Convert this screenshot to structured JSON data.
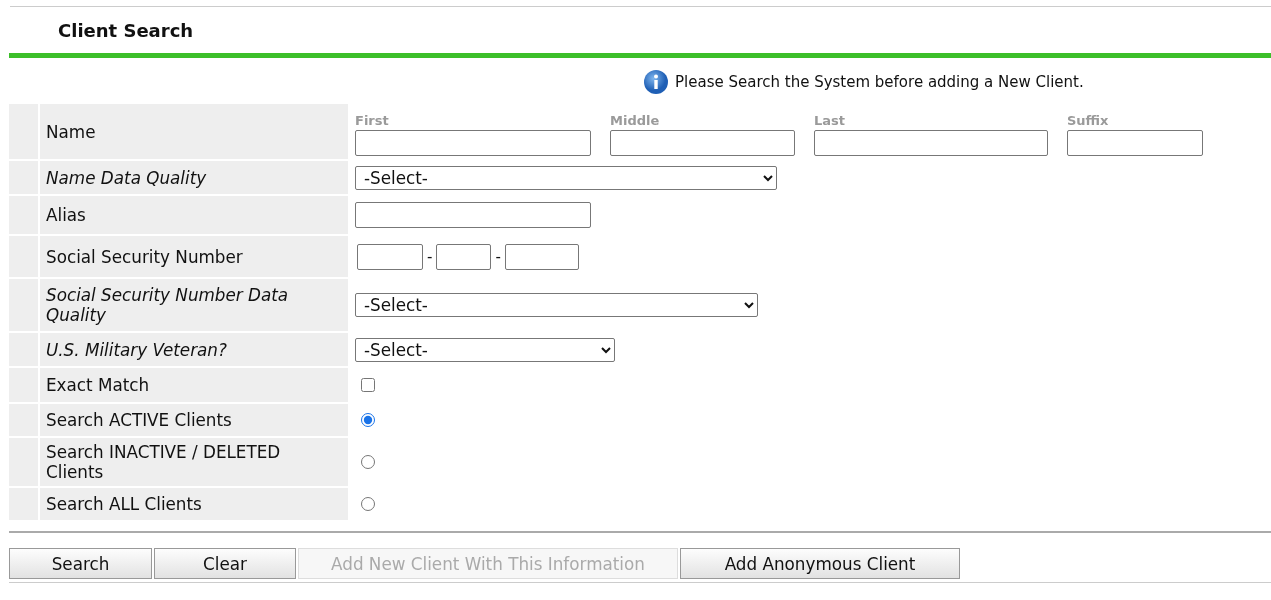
{
  "header": {
    "title": "Client Search"
  },
  "notice": {
    "text": "Please Search the System before adding a New Client."
  },
  "form": {
    "rows": [
      {
        "kind": "name",
        "label": "Name",
        "italic": false,
        "fields": [
          {
            "label": "First"
          },
          {
            "label": "Middle"
          },
          {
            "label": "Last"
          },
          {
            "label": "Suffix"
          }
        ]
      },
      {
        "kind": "select",
        "label": "Name Data Quality",
        "italic": true,
        "value": "-Select-"
      },
      {
        "kind": "text",
        "label": "Alias",
        "italic": false
      },
      {
        "kind": "ssn",
        "label": "Social Security Number",
        "italic": false,
        "separators": [
          "-",
          "-"
        ]
      },
      {
        "kind": "select",
        "label": "Social Security Number Data Quality",
        "italic": true,
        "value": "-Select-"
      },
      {
        "kind": "select",
        "label": "U.S. Military Veteran?",
        "italic": true,
        "value": "-Select-"
      },
      {
        "kind": "checkbox",
        "label": "Exact Match",
        "italic": false,
        "checked": false
      },
      {
        "kind": "radio",
        "label": "Search ACTIVE Clients",
        "italic": false,
        "selected": true
      },
      {
        "kind": "radio",
        "label": "Search INACTIVE / DELETED Clients",
        "italic": false,
        "selected": false
      },
      {
        "kind": "radio",
        "label": "Search ALL Clients",
        "italic": false,
        "selected": false
      }
    ]
  },
  "buttons": [
    {
      "label": "Search",
      "disabled": false
    },
    {
      "label": "Clear",
      "disabled": false
    },
    {
      "label": "Add New Client With This Information",
      "disabled": true
    },
    {
      "label": "Add Anonymous Client",
      "disabled": false
    }
  ]
}
